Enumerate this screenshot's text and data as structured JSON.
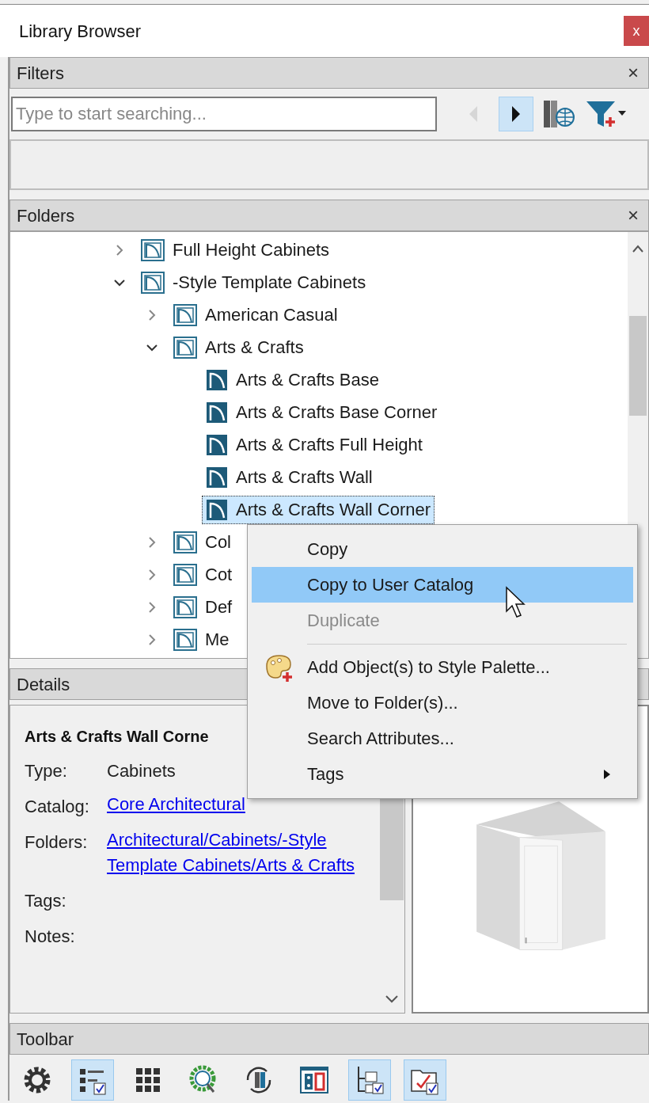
{
  "window": {
    "title": "Library Browser",
    "close": "x"
  },
  "filters": {
    "title": "Filters",
    "close": "×",
    "search": {
      "placeholder": "Type to start searching..."
    },
    "buttons": [
      {
        "kind": "back",
        "selected": false,
        "disabled": true
      },
      {
        "kind": "forward",
        "selected": true,
        "disabled": false
      },
      {
        "kind": "catalog",
        "selected": false,
        "disabled": false
      },
      {
        "kind": "filter",
        "selected": false,
        "disabled": false
      }
    ]
  },
  "folders": {
    "title": "Folders",
    "close": "×",
    "tree": [
      {
        "label": "Full Height Cabinets",
        "kind": "folder",
        "expanded": false,
        "selected": false
      },
      {
        "label": "-Style Template Cabinets",
        "kind": "folder",
        "expanded": true,
        "selected": false,
        "children": [
          {
            "label": "American Casual",
            "kind": "folder",
            "expanded": false,
            "selected": false
          },
          {
            "label": "Arts & Crafts",
            "kind": "folder",
            "expanded": true,
            "selected": false,
            "children": [
              {
                "label": "Arts & Crafts Base",
                "kind": "item",
                "selected": false
              },
              {
                "label": "Arts & Crafts Base Corner",
                "kind": "item",
                "selected": false
              },
              {
                "label": "Arts & Crafts Full Height",
                "kind": "item",
                "selected": false
              },
              {
                "label": "Arts & Crafts Wall",
                "kind": "item",
                "selected": false
              },
              {
                "label": "Arts & Crafts Wall Corner",
                "kind": "item",
                "selected": true
              }
            ]
          },
          {
            "label": "Col",
            "kind": "folder",
            "expanded": false,
            "selected": false
          },
          {
            "label": "Cot",
            "kind": "folder",
            "expanded": false,
            "selected": false
          },
          {
            "label": "Def",
            "kind": "folder",
            "expanded": false,
            "selected": false
          },
          {
            "label": "Me",
            "kind": "folder",
            "expanded": false,
            "selected": false
          }
        ]
      }
    ]
  },
  "context_menu": {
    "items": [
      {
        "kind": "item",
        "label": "Copy",
        "selected": false,
        "disabled": false,
        "submenu": false
      },
      {
        "kind": "item",
        "label": "Copy to User Catalog",
        "selected": true,
        "disabled": false,
        "submenu": false
      },
      {
        "kind": "item",
        "label": "Duplicate",
        "selected": false,
        "disabled": true,
        "submenu": false
      },
      {
        "kind": "separator"
      },
      {
        "kind": "palette-item",
        "label": "Add Object(s) to Style Palette...",
        "selected": false,
        "disabled": false,
        "submenu": false
      },
      {
        "kind": "item",
        "label": "Move to Folder(s)...",
        "selected": false,
        "disabled": false,
        "submenu": false
      },
      {
        "kind": "item",
        "label": "Search Attributes...",
        "selected": false,
        "disabled": false,
        "submenu": false
      },
      {
        "kind": "item",
        "label": "Tags",
        "selected": false,
        "disabled": false,
        "submenu": true
      }
    ]
  },
  "details": {
    "title": "Details",
    "name": "Arts & Crafts Wall Corne",
    "fields": [
      {
        "label": "Type:",
        "value": "Cabinets",
        "kind": "text"
      },
      {
        "label": "Catalog:",
        "value": "Core Architectural",
        "kind": "link"
      },
      {
        "label": "Folders:",
        "value": "Architectural/Cabinets/-Style Template Cabinets/Arts & Crafts",
        "kind": "link"
      },
      {
        "label": "Tags:"
      },
      {
        "label": "Notes:"
      }
    ]
  },
  "toolbar": {
    "title": "Toolbar",
    "buttons": [
      {
        "kind": "settings",
        "selected": false
      },
      {
        "kind": "list",
        "selected": true
      },
      {
        "kind": "grid",
        "selected": false
      },
      {
        "kind": "search",
        "selected": false
      },
      {
        "kind": "refresh",
        "selected": false
      },
      {
        "kind": "plan",
        "selected": false
      },
      {
        "kind": "folder-tree",
        "selected": true
      },
      {
        "kind": "folder-check",
        "selected": true
      }
    ]
  }
}
